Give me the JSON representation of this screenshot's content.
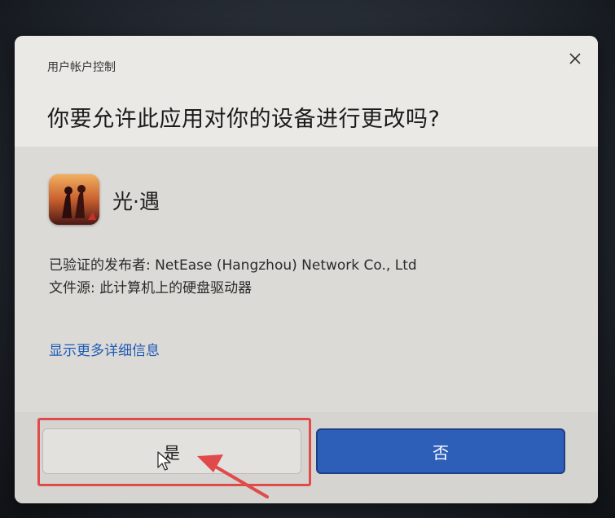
{
  "dialog": {
    "window_title": "用户帐户控制",
    "question": "你要允许此应用对你的设备进行更改吗?",
    "app": {
      "name": "光·遇",
      "icon": "sky-game-icon"
    },
    "publisher_line": "已验证的发布者: NetEase (Hangzhou) Network Co., Ltd",
    "source_line": "文件源: 此计算机上的硬盘驱动器",
    "more_details": "显示更多详细信息",
    "buttons": {
      "yes": "是",
      "no": "否"
    }
  },
  "colors": {
    "primary_button": "#2e5fb8",
    "annotation": "#e04a4a",
    "link": "#1f5bb5"
  }
}
